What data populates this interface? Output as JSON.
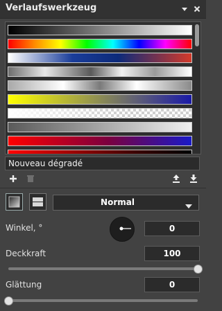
{
  "panel": {
    "title": "Verlaufswerkzeug",
    "icons": [
      "dropdown-menu-icon",
      "close-icon"
    ]
  },
  "gradients": [
    {
      "css": "linear-gradient(90deg,#000000,#ffffff)"
    },
    {
      "css": "linear-gradient(90deg,#ff0000,#ff8a00,#ffff00,#00ff00,#00ffff,#0000ff,#ff00ff,#ff0000)"
    },
    {
      "css": "linear-gradient(90deg,#ffffff,#1a3d9a 35%,#0c2a7a 60%,#d43a2a)"
    },
    {
      "css": "linear-gradient(90deg,#6f6f6f,#e8e8e8 20%,#5a5a5a 45%,#f2f2f2 62%,#9a9a9a 80%,#ffffff)"
    },
    {
      "css": "linear-gradient(90deg,#a9a9a9,#ffffff 30%,#7a7a7a 50%,#ffffff 70%,#8a8a8a)"
    },
    {
      "css": "linear-gradient(90deg,#ffff00,#1a1aa8)"
    },
    {
      "css": "checker"
    },
    {
      "css": "linear-gradient(90deg,#5a5a5a,#f0f0f0)"
    },
    {
      "css": "linear-gradient(90deg,#ff0000,#7a0040 55%,#1a1ac8)"
    },
    {
      "css": "linear-gradient(90deg,#ff0000,#3a0000 70%,#000000)"
    }
  ],
  "gradient_name": "Nouveau dégradé",
  "actions": {
    "add_icon": "plus-icon",
    "delete_icon": "trash-icon",
    "import_icon": "upload-icon",
    "export_icon": "download-icon"
  },
  "blend_mode": "Normal",
  "angle": {
    "label": "Winkel, °",
    "value": "0"
  },
  "opacity": {
    "label": "Deckkraft",
    "value": "100",
    "fraction": 1.0
  },
  "smoothing": {
    "label": "Glättung",
    "value": "0",
    "fraction": 0.0
  }
}
